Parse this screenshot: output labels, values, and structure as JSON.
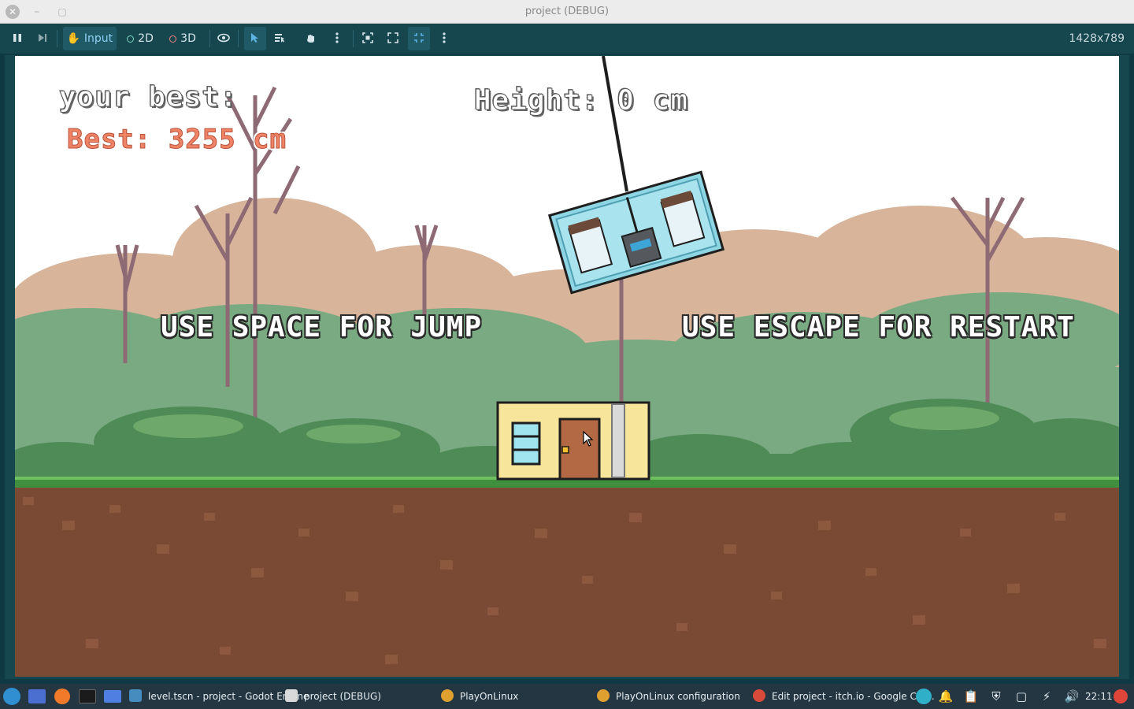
{
  "window": {
    "title": "project (DEBUG)",
    "close_icon": "close-icon",
    "minimize_icon": "minimize-icon",
    "maximize_icon": "maximize-icon"
  },
  "toolbar": {
    "input_label": "Input",
    "mode_2d_label": "2D",
    "mode_3d_label": "3D",
    "resolution": "1428x789",
    "icons": [
      "pause-icon",
      "step-icon",
      "input-icon",
      "visibility-icon",
      "select-icon",
      "list-select-icon",
      "hand-icon",
      "more-icon",
      "camera-reset-icon",
      "fullscreen-icon",
      "fit-icon",
      "more-icon"
    ]
  },
  "game": {
    "your_best_label": "your best:",
    "best_score": "Best: 3255 cm",
    "height_readout": "Height: 0 cm",
    "hint_jump": "USE SPACE FOR JUMP",
    "hint_restart": "USE ESCAPE FOR RESTART"
  },
  "taskbar": {
    "items": [
      {
        "label": "level.tscn - project - Godot Engine"
      },
      {
        "label": "project (DEBUG)"
      },
      {
        "label": "PlayOnLinux"
      },
      {
        "label": "PlayOnLinux configuration"
      },
      {
        "label": "Edit project - itch.io - Google Chr..."
      }
    ],
    "clock": "22:11"
  },
  "colors": {
    "toolbar_bg": "#16474f",
    "taskbar_bg": "#243642",
    "best_score": "#f08366",
    "sky": "#ffffff",
    "dirt": "#7a4a35",
    "grass": "#3f8f3f"
  }
}
